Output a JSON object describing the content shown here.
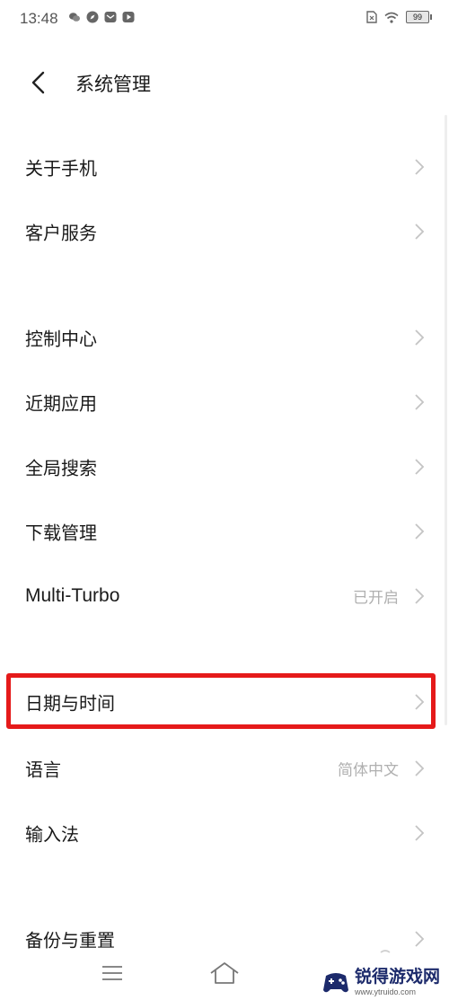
{
  "status_bar": {
    "time": "13:48",
    "left_icons": [
      "wechat-icon",
      "compass-icon",
      "message-icon",
      "play-icon"
    ],
    "right_icons": [
      "sim-icon",
      "wifi-icon"
    ],
    "battery": "99"
  },
  "header": {
    "back_icon": "chevron-left-icon",
    "title": "系统管理"
  },
  "settings": {
    "about_phone": {
      "label": "关于手机"
    },
    "customer_service": {
      "label": "客户服务"
    },
    "control_center": {
      "label": "控制中心"
    },
    "recent_apps": {
      "label": "近期应用"
    },
    "global_search": {
      "label": "全局搜索"
    },
    "download_manager": {
      "label": "下载管理"
    },
    "multi_turbo": {
      "label": "Multi-Turbo",
      "value": "已开启"
    },
    "date_time": {
      "label": "日期与时间"
    },
    "language": {
      "label": "语言",
      "value": "简体中文"
    },
    "input_method": {
      "label": "输入法"
    },
    "backup_reset": {
      "label": "备份与重置"
    }
  },
  "highlight_color": "#e51a1a",
  "nav_bar": {
    "icons": [
      "menu-icon",
      "home-icon",
      "back-nav-icon"
    ]
  },
  "watermark": {
    "name": "锐得游戏网",
    "url": "www.ytruido.com"
  }
}
